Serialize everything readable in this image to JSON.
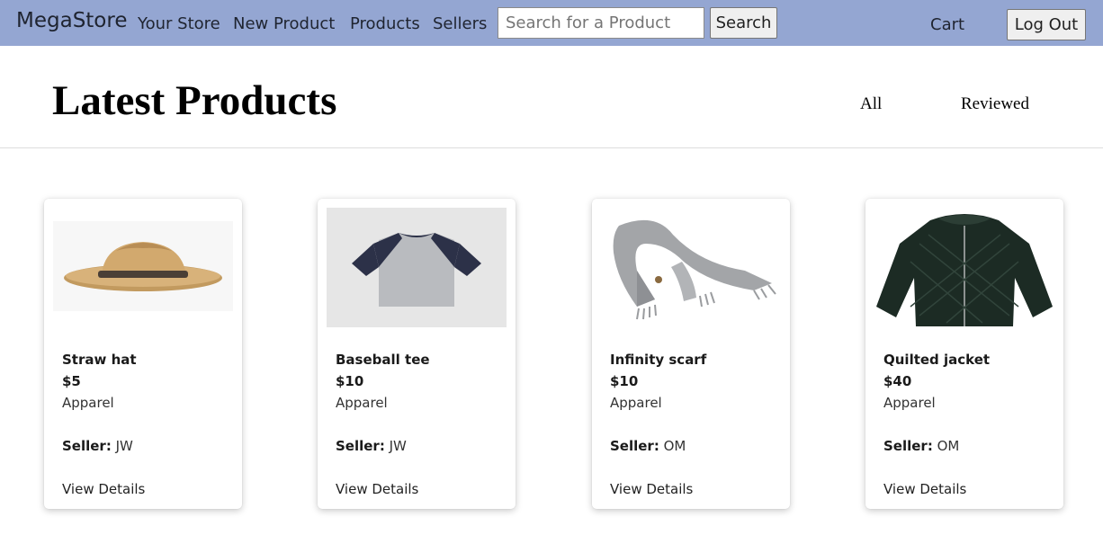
{
  "navbar": {
    "brand": "MegaStore",
    "links": [
      "Your Store",
      "New Product",
      "Products",
      "Sellers"
    ],
    "search_placeholder": "Search for a Product",
    "search_button": "Search",
    "cart": "Cart",
    "logout": "Log Out"
  },
  "header": {
    "title": "Latest Products",
    "filters": [
      "All",
      "Reviewed"
    ]
  },
  "products": [
    {
      "name": "Straw hat",
      "price": "$5",
      "category": "Apparel",
      "seller_label": "Seller:",
      "seller": "JW",
      "link": "View Details",
      "image": "straw-hat"
    },
    {
      "name": "Baseball tee",
      "price": "$10",
      "category": "Apparel",
      "seller_label": "Seller:",
      "seller": "JW",
      "link": "View Details",
      "image": "baseball-tee"
    },
    {
      "name": "Infinity scarf",
      "price": "$10",
      "category": "Apparel",
      "seller_label": "Seller:",
      "seller": "OM",
      "link": "View Details",
      "image": "infinity-scarf"
    },
    {
      "name": "Quilted jacket",
      "price": "$40",
      "category": "Apparel",
      "seller_label": "Seller:",
      "seller": "OM",
      "link": "View Details",
      "image": "quilted-jacket"
    }
  ],
  "colors": {
    "navbar_bg": "#94a6d2"
  }
}
